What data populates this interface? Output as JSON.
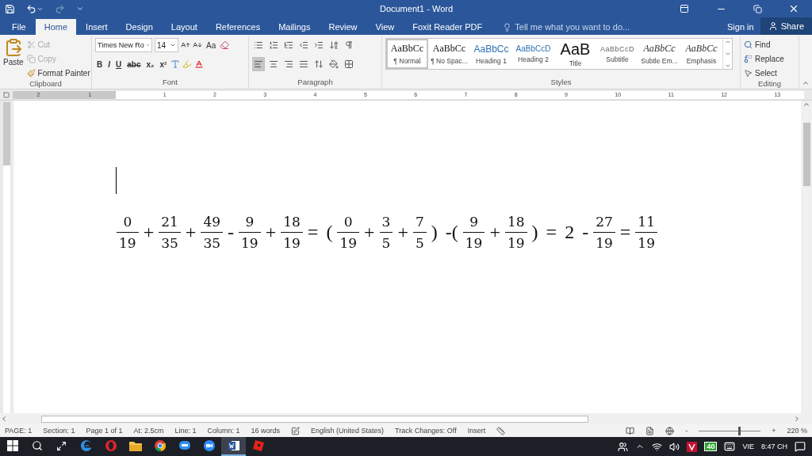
{
  "title_bar": {
    "title": "Document1 - Word"
  },
  "tabs": [
    {
      "label": "File",
      "selected": false
    },
    {
      "label": "Home",
      "selected": true
    },
    {
      "label": "Insert",
      "selected": false
    },
    {
      "label": "Design",
      "selected": false
    },
    {
      "label": "Layout",
      "selected": false
    },
    {
      "label": "References",
      "selected": false
    },
    {
      "label": "Mailings",
      "selected": false
    },
    {
      "label": "Review",
      "selected": false
    },
    {
      "label": "View",
      "selected": false
    },
    {
      "label": "Foxit Reader PDF",
      "selected": false
    }
  ],
  "tell_me": {
    "placeholder": "Tell me what you want to do..."
  },
  "account": {
    "sign_in": "Sign in",
    "share": "Share"
  },
  "ribbon": {
    "clipboard": {
      "label": "Clipboard",
      "paste": "Paste",
      "items": [
        {
          "kind": "cut",
          "label": "Cut",
          "disabled": true
        },
        {
          "kind": "copy",
          "label": "Copy",
          "disabled": true
        },
        {
          "kind": "painter",
          "label": "Format Painter",
          "disabled": false
        }
      ]
    },
    "font": {
      "label": "Font",
      "name": "Times New Ro",
      "size": "14",
      "case_button": "Aa",
      "format_buttons": [
        "B",
        "I",
        "U",
        "abc",
        "x₂",
        "x²"
      ]
    },
    "paragraph": {
      "label": "Paragraph",
      "align": [
        {
          "kind": "left",
          "selected": true
        },
        {
          "kind": "center",
          "selected": false
        },
        {
          "kind": "right",
          "selected": false
        },
        {
          "kind": "justify",
          "selected": false
        }
      ]
    },
    "styles": {
      "label": "Styles",
      "items": [
        {
          "preview": "AaBbCc",
          "name": "¶ Normal",
          "kind": "normal",
          "selected": true
        },
        {
          "preview": "AaBbCc",
          "name": "¶ No Spac...",
          "kind": "normal",
          "selected": false
        },
        {
          "preview": "AaBbCc",
          "name": "Heading 1",
          "kind": "heading1",
          "selected": false
        },
        {
          "preview": "AaBbCcD",
          "name": "Heading 2",
          "kind": "heading2",
          "selected": false
        },
        {
          "preview": "AaB",
          "name": "Title",
          "kind": "title",
          "selected": false
        },
        {
          "preview": "AaBbCcD",
          "name": "Subtitle",
          "kind": "subtitle",
          "selected": false
        },
        {
          "preview": "AaBbCc",
          "name": "Subtle Em...",
          "kind": "emphasis",
          "selected": false
        },
        {
          "preview": "AaBbCc",
          "name": "Emphasis",
          "kind": "emphasis",
          "selected": false
        }
      ]
    },
    "editing": {
      "label": "Editing",
      "items": [
        {
          "kind": "find",
          "label": "Find"
        },
        {
          "kind": "replace",
          "label": "Replace"
        },
        {
          "kind": "select",
          "label": "Select"
        }
      ]
    }
  },
  "ruler": {
    "left_labels": [
      "2",
      "1"
    ],
    "labels": [
      "1",
      "2",
      "3",
      "4",
      "5",
      "6",
      "7",
      "8",
      "9",
      "10",
      "11",
      "12",
      "13"
    ]
  },
  "document": {
    "equation": [
      {
        "kind": "frac",
        "num": "0",
        "den": "19"
      },
      {
        "kind": "op",
        "text": "+"
      },
      {
        "kind": "frac",
        "num": "21",
        "den": "35"
      },
      {
        "kind": "op",
        "text": "+"
      },
      {
        "kind": "frac",
        "num": "49",
        "den": "35"
      },
      {
        "kind": "op",
        "text": "-"
      },
      {
        "kind": "frac",
        "num": "9",
        "den": "19"
      },
      {
        "kind": "op",
        "text": "+"
      },
      {
        "kind": "frac",
        "num": "18",
        "den": "19"
      },
      {
        "kind": "op",
        "text": "="
      },
      {
        "kind": "op",
        "text": "("
      },
      {
        "kind": "frac",
        "num": "0",
        "den": "19"
      },
      {
        "kind": "op",
        "text": "+"
      },
      {
        "kind": "frac",
        "num": "3",
        "den": "5"
      },
      {
        "kind": "op",
        "text": "+"
      },
      {
        "kind": "frac",
        "num": "7",
        "den": "5"
      },
      {
        "kind": "op",
        "text": ")"
      },
      {
        "kind": "op",
        "text": "-("
      },
      {
        "kind": "frac",
        "num": "9",
        "den": "19"
      },
      {
        "kind": "op",
        "text": "+"
      },
      {
        "kind": "frac",
        "num": "18",
        "den": "19"
      },
      {
        "kind": "op",
        "text": ")"
      },
      {
        "kind": "op",
        "text": "="
      },
      {
        "kind": "op",
        "text": "2"
      },
      {
        "kind": "op",
        "text": "-"
      },
      {
        "kind": "frac",
        "num": "27",
        "den": "19"
      },
      {
        "kind": "op",
        "text": "="
      },
      {
        "kind": "frac",
        "num": "11",
        "den": "19"
      }
    ]
  },
  "status_bar": {
    "items": [
      "PAGE: 1",
      "Section: 1",
      "Page 1 of 1",
      "At: 2.5cm",
      "Line: 1",
      "Column: 1",
      "16 words"
    ],
    "language": "English (United States)",
    "track_changes": "Track Changes: Off",
    "mode": "Insert",
    "zoom_out": "-",
    "zoom_in": "+",
    "zoom": {
      "level": 0.64,
      "reading": "220 %"
    }
  },
  "taskbar": {
    "apps": [
      {
        "kind": "edge",
        "selected": false
      },
      {
        "kind": "opera",
        "selected": false
      },
      {
        "kind": "folder",
        "selected": false
      },
      {
        "kind": "chrome",
        "selected": false
      },
      {
        "kind": "chat",
        "selected": false
      },
      {
        "kind": "video",
        "selected": false
      },
      {
        "kind": "word",
        "selected": true
      },
      {
        "kind": "game",
        "selected": false
      }
    ],
    "badge": "40",
    "language": "VIE",
    "time": "8:47 CH"
  }
}
